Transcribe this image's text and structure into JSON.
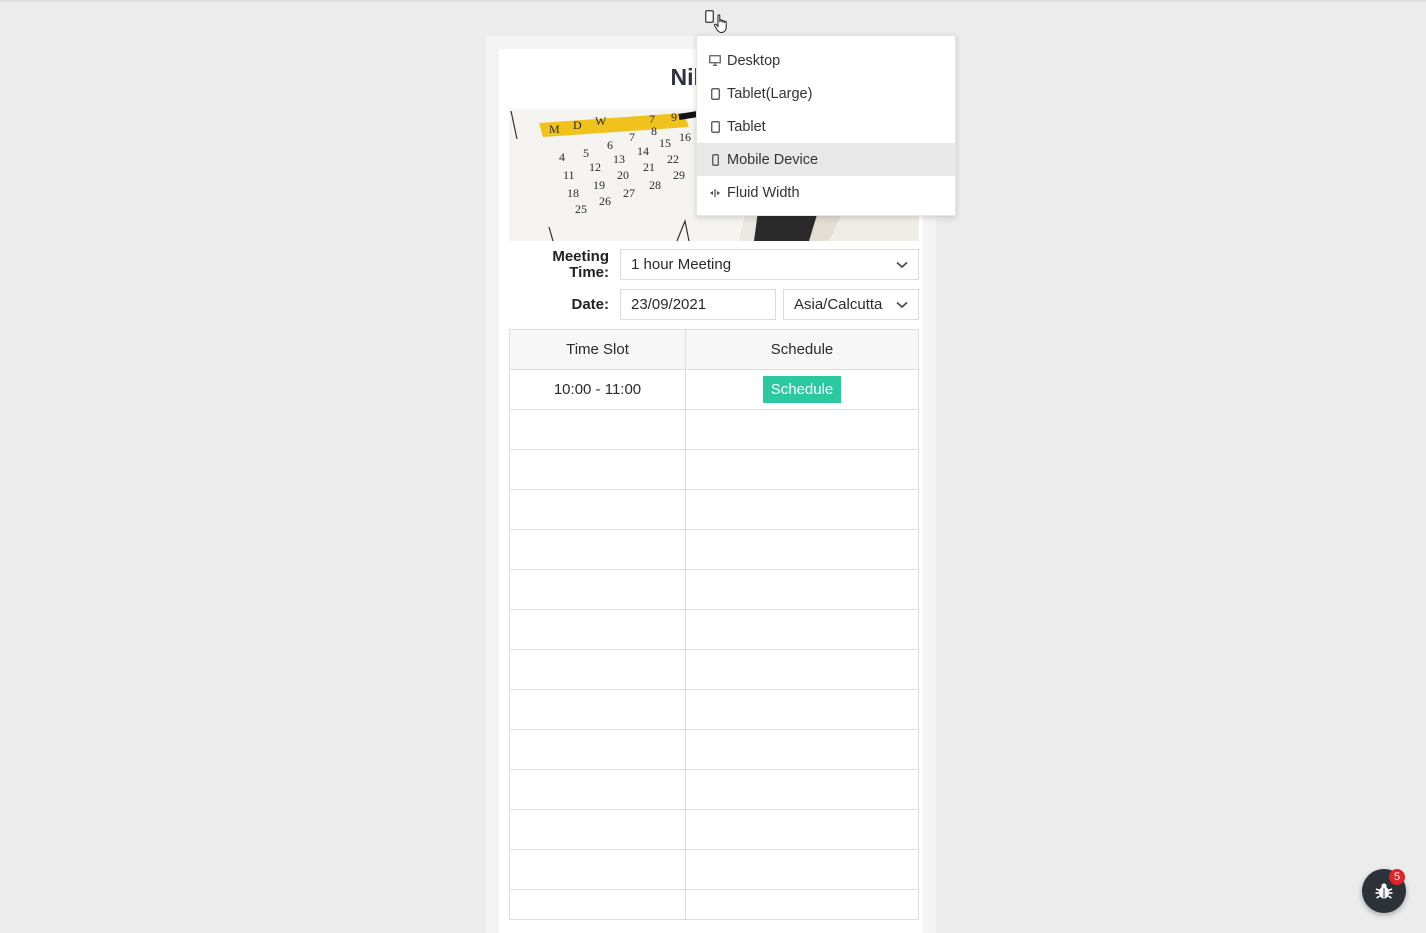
{
  "page": {
    "title": "Nikhil's"
  },
  "form": {
    "meeting_time_label_1": "Meeting",
    "meeting_time_label_2": "Time:",
    "meeting_time_value": "1 hour Meeting",
    "date_label": "Date:",
    "date_value": "23/09/2021",
    "timezone_value": "Asia/Calcutta"
  },
  "table": {
    "headers": [
      "Time Slot",
      "Schedule"
    ],
    "rows": [
      {
        "slot": "10:00 - 11:00",
        "action": "Schedule"
      }
    ]
  },
  "device_menu": {
    "items": [
      {
        "label": "Desktop",
        "icon": "desktop-icon"
      },
      {
        "label": "Tablet(Large)",
        "icon": "tablet-icon"
      },
      {
        "label": "Tablet",
        "icon": "tablet-icon"
      },
      {
        "label": "Mobile Device",
        "icon": "mobile-icon",
        "active": true
      },
      {
        "label": "Fluid Width",
        "icon": "fluid-width-icon"
      }
    ]
  },
  "debug": {
    "badge_count": "5"
  },
  "colors": {
    "accent": "#2ac9a0",
    "badge": "#e0242b",
    "menu_active": "#e8e8e8"
  }
}
